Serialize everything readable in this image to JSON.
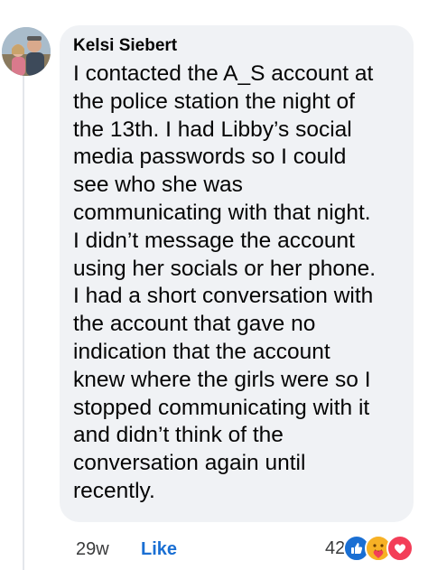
{
  "comment": {
    "author": "Kelsi Siebert",
    "text": "I contacted the A_S account at the police station the night of the 13th. I had Libby’s social media passwords so I could see who she was communicating with that night. I didn’t message the account using her socials or her phone. I had a short conversation with the account that gave no indication that the account knew where the girls were so I stopped communicating with it and didn’t think of the conversation again until recently.",
    "lines": [
      "I contacted the A_S account at",
      "the police station the night of",
      "the 13th. I had Libby’s social",
      "media passwords so I could",
      "see who she was",
      "communicating with that night.",
      "I didn’t message the account",
      "using her socials or her phone.",
      "I had a short conversation with",
      "the account that gave no",
      "indication that the account",
      "knew where the girls were so I",
      "stopped communicating with it",
      "and didn’t think of the",
      "conversation again until",
      "recently."
    ]
  },
  "footer": {
    "time": "29w",
    "like_label": "Like",
    "reaction_count": "42",
    "reactions": [
      "like-icon",
      "care-icon",
      "love-icon"
    ]
  },
  "colors": {
    "bubble": "#f0f2f5",
    "like_blue": "#1a6fd3",
    "love_red": "#f33e58",
    "care_yellow": "#f7b125"
  }
}
